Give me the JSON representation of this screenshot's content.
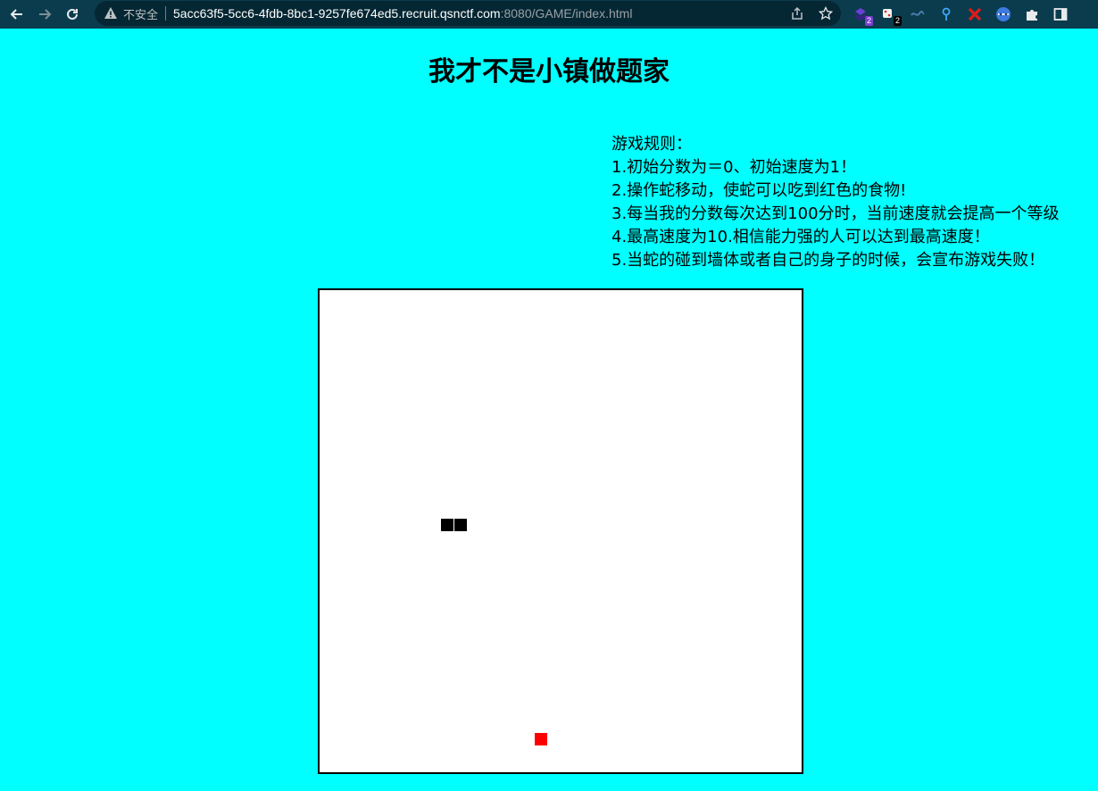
{
  "browser": {
    "insecure_label": "不安全",
    "url_host": "5acc63f5-5cc6-4fdb-8bc1-9257fe674ed5.recruit.qsnctf.com",
    "url_rest": ":8080/GAME/index.html",
    "extensions": [
      {
        "icon": "purple-extension-icon",
        "badge": "2",
        "badge_color": "#7b3fd1"
      },
      {
        "icon": "dice-extension-icon",
        "badge": "2",
        "badge_color": "#000000"
      },
      {
        "icon": "wave-extension-icon"
      },
      {
        "icon": "location-pin-icon"
      },
      {
        "icon": "red-x-extension-icon"
      },
      {
        "icon": "mask-extension-icon"
      },
      {
        "icon": "puzzle-extensions-icon"
      },
      {
        "icon": "side-panel-icon"
      }
    ]
  },
  "page": {
    "title": "我才不是小镇做题家",
    "rules": [
      "游戏规则：",
      "1.初始分数为＝0、初始速度为1！",
      "2.操作蛇移动，使蛇可以吃到红色的食物!",
      "3.每当我的分数每次达到100分时，当前速度就会提高一个等级",
      "4.最高速度为10.相信能力强的人可以达到最高速度！",
      "5.当蛇的碰到墙体或者自己的身子的时候，会宣布游戏失败！"
    ]
  },
  "game": {
    "snake_color": "#000000",
    "food_color": "#ff0000",
    "background_color": "#00ffff"
  }
}
